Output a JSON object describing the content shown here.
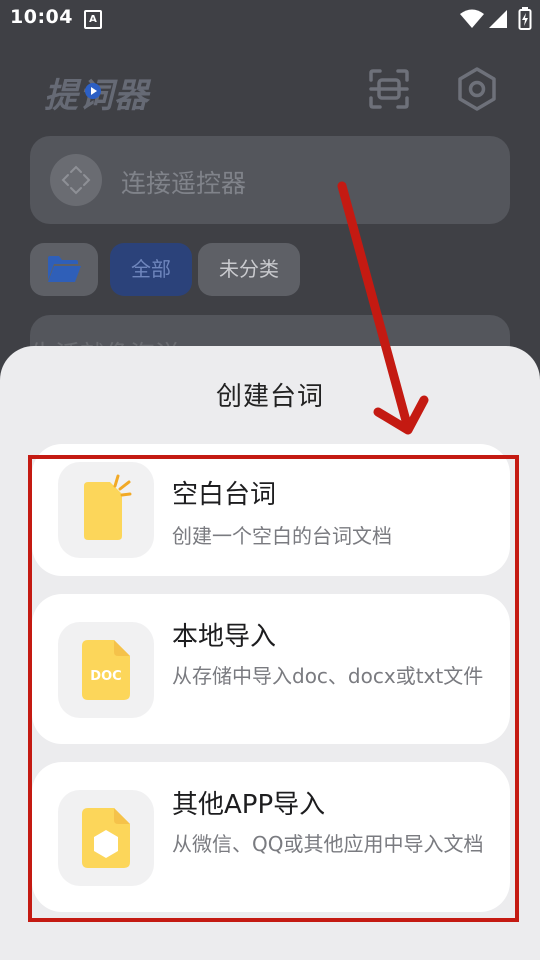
{
  "status_bar": {
    "time": "10:04",
    "notification_glyph": "A"
  },
  "header": {
    "app_title": "提词器"
  },
  "remote": {
    "label": "连接遥控器"
  },
  "filters": {
    "all": "全部",
    "uncategorized": "未分类"
  },
  "list": {
    "first_item_title": "生活就像海洋"
  },
  "sheet": {
    "title": "创建台词",
    "options": [
      {
        "title": "空白台词",
        "desc": "创建一个空白的台词文档",
        "icon": "blank-document-icon"
      },
      {
        "title": "本地导入",
        "desc": "从存储中导入doc、docx或txt文件",
        "icon": "doc-file-icon",
        "icon_text": "DOC"
      },
      {
        "title": "其他APP导入",
        "desc": "从微信、QQ或其他应用中导入文档",
        "icon": "app-import-file-icon"
      }
    ]
  },
  "colors": {
    "accent_yellow": "#fcd65a",
    "annotation_red": "#c41a12",
    "chip_active": "#2b427a"
  }
}
